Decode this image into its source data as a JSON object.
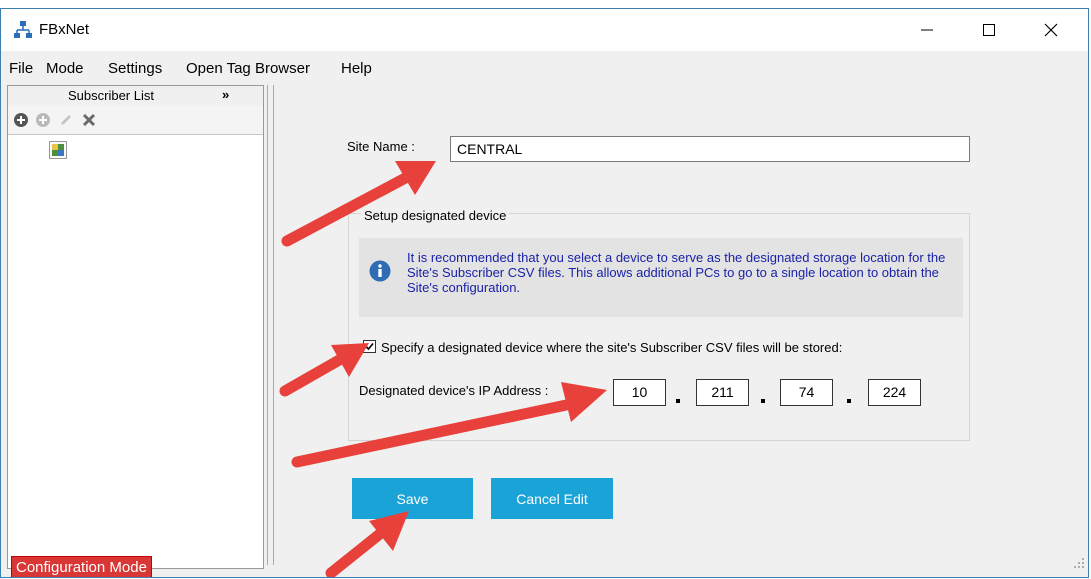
{
  "window": {
    "title": "FBxNet"
  },
  "menu": {
    "items": [
      "File",
      "Mode",
      "Settings",
      "Open Tag Browser",
      "Help"
    ]
  },
  "subscriber_panel": {
    "title": "Subscriber List",
    "collapse_glyph": "»"
  },
  "form": {
    "site_name_label": "Site Name :",
    "site_name_value": "CENTRAL",
    "group_title": "Setup designated device",
    "info_text": "It is recommended that you select a device to serve as the designated storage location for the Site's Subscriber CSV files. This allows additional PCs  to go to a single location to obtain the Site's configuration.",
    "checkbox_label": "Specify a designated device where the site's Subscriber CSV files will be stored:",
    "checkbox_checked": true,
    "ip_label": "Designated device's IP Address :",
    "ip_octets": [
      "10",
      "211",
      "74",
      "224"
    ]
  },
  "buttons": {
    "save_label": "Save",
    "cancel_label": "Cancel Edit"
  },
  "status": {
    "mode_label": "Configuration Mode"
  },
  "colors": {
    "accent_button": "#1aa3d7",
    "status_badge": "#d93636",
    "annotation_arrow": "#e8403a",
    "info_text": "#1a22a8"
  }
}
